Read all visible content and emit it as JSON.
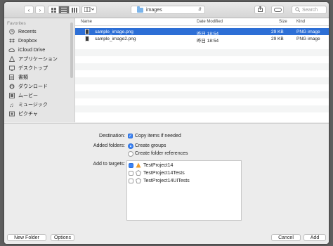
{
  "toolbar": {
    "back_icon": "chevron-left-icon",
    "forward_icon": "chevron-right-icon",
    "location": "images",
    "search_placeholder": "Search"
  },
  "sidebar": {
    "title": "Favorites",
    "items": [
      {
        "label": "Recents",
        "icon": "clock-icon"
      },
      {
        "label": "Dropbox",
        "icon": "dropbox-icon"
      },
      {
        "label": "iCloud Drive",
        "icon": "cloud-icon"
      },
      {
        "label": "アプリケーション",
        "icon": "applications-icon"
      },
      {
        "label": "デスクトップ",
        "icon": "desktop-icon"
      },
      {
        "label": "書類",
        "icon": "documents-icon"
      },
      {
        "label": "ダウンロード",
        "icon": "downloads-icon"
      },
      {
        "label": "ムービー",
        "icon": "movies-icon"
      },
      {
        "label": "ミュージック",
        "icon": "music-icon"
      },
      {
        "label": "ピクチャ",
        "icon": "pictures-icon"
      }
    ]
  },
  "filelist": {
    "columns": {
      "name": "Name",
      "date": "Date Modified",
      "size": "Size",
      "kind": "Kind"
    },
    "rows": [
      {
        "name": "sample_image.png",
        "date": "昨日 18:54",
        "size": "29 KB",
        "kind": "PNG image",
        "selected": true
      },
      {
        "name": "sample_image2.png",
        "date": "昨日 18:54",
        "size": "29 KB",
        "kind": "PNG image",
        "selected": false
      }
    ]
  },
  "options": {
    "destination_label": "Destination:",
    "destination_option": "Copy items if needed",
    "added_folders_label": "Added folders:",
    "create_groups": "Create groups",
    "create_folder_refs": "Create folder references",
    "add_to_targets_label": "Add to targets:",
    "targets": [
      {
        "name": "TestProject14",
        "checked": true,
        "icon": "app-target-icon"
      },
      {
        "name": "TestProject14Tests",
        "checked": false,
        "icon": "test-target-icon"
      },
      {
        "name": "TestProject14UITests",
        "checked": false,
        "icon": "test-target-icon"
      }
    ]
  },
  "footer": {
    "new_folder": "New Folder",
    "options": "Options",
    "cancel": "Cancel",
    "add": "Add"
  },
  "colors": {
    "selection": "#2d6fd6",
    "checkbox": "#3a82f7"
  }
}
